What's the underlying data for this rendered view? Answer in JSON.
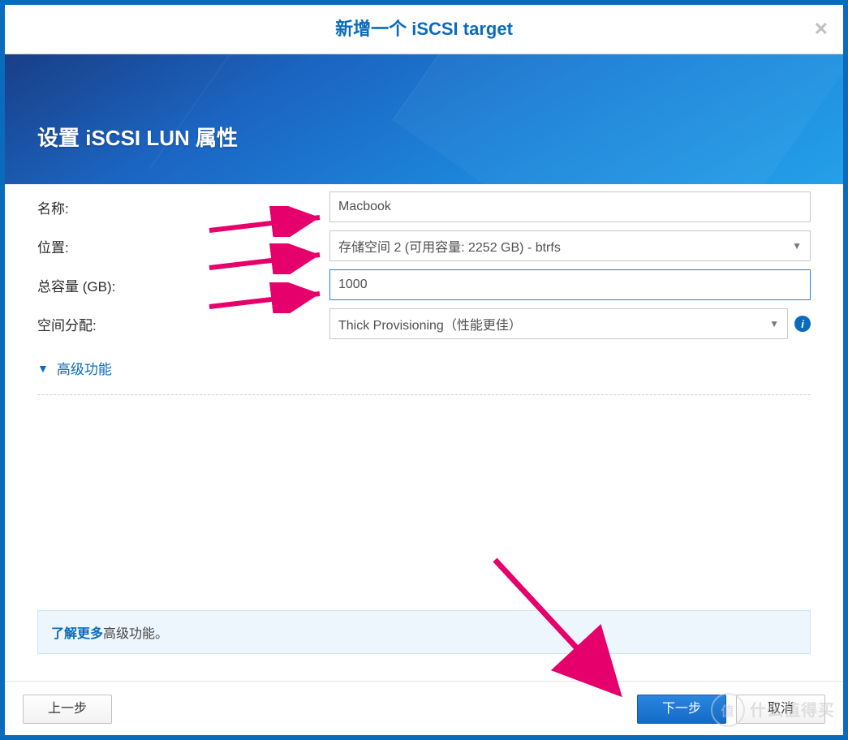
{
  "window_title": "新增一个 iSCSI target",
  "banner_heading": "设置 iSCSI LUN 属性",
  "form": {
    "name_label": "名称:",
    "name_value": "Macbook",
    "location_label": "位置:",
    "location_value": "存储空间 2 (可用容量: 2252 GB) - btrfs",
    "capacity_label": "总容量 (GB):",
    "capacity_value": "1000",
    "alloc_label": "空间分配:",
    "alloc_value": "Thick Provisioning（性能更佳）"
  },
  "advanced_label": "高级功能",
  "hint": {
    "link": "了解更多",
    "rest": "高级功能。"
  },
  "buttons": {
    "back": "上一步",
    "next": "下一步",
    "cancel": "取消"
  },
  "watermark": {
    "badge": "值",
    "text": "什么值得买"
  }
}
